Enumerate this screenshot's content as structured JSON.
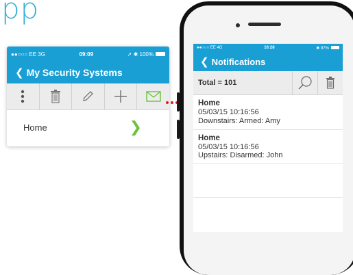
{
  "title": "pp",
  "card": {
    "status": {
      "carrier": "●●○○○ EE  3G",
      "time": "09:09",
      "right": "100%"
    },
    "nav_title": "My Security Systems",
    "toolbar_icons": [
      "more-vertical-icon",
      "trash-icon",
      "pencil-icon",
      "plus-icon",
      "envelope-icon"
    ],
    "row_label": "Home"
  },
  "phone": {
    "status": {
      "carrier": "●●○○○ EE  4G",
      "time": "10:28",
      "right": "97%"
    },
    "nav_title": "Notifications",
    "total": "Total = 101",
    "notifications": [
      {
        "location": "Home",
        "timestamp": "05/03/15 10:16:56",
        "message": "Downstairs: Armed: Amy"
      },
      {
        "location": "Home",
        "timestamp": "05/03/15 10:16:56",
        "message": "Upstairs: Disarmed: John"
      }
    ]
  },
  "colors": {
    "accent": "#1a9fd5",
    "heading": "#3aaed8",
    "green": "#6bc23a",
    "connector": "#e01b1b"
  }
}
